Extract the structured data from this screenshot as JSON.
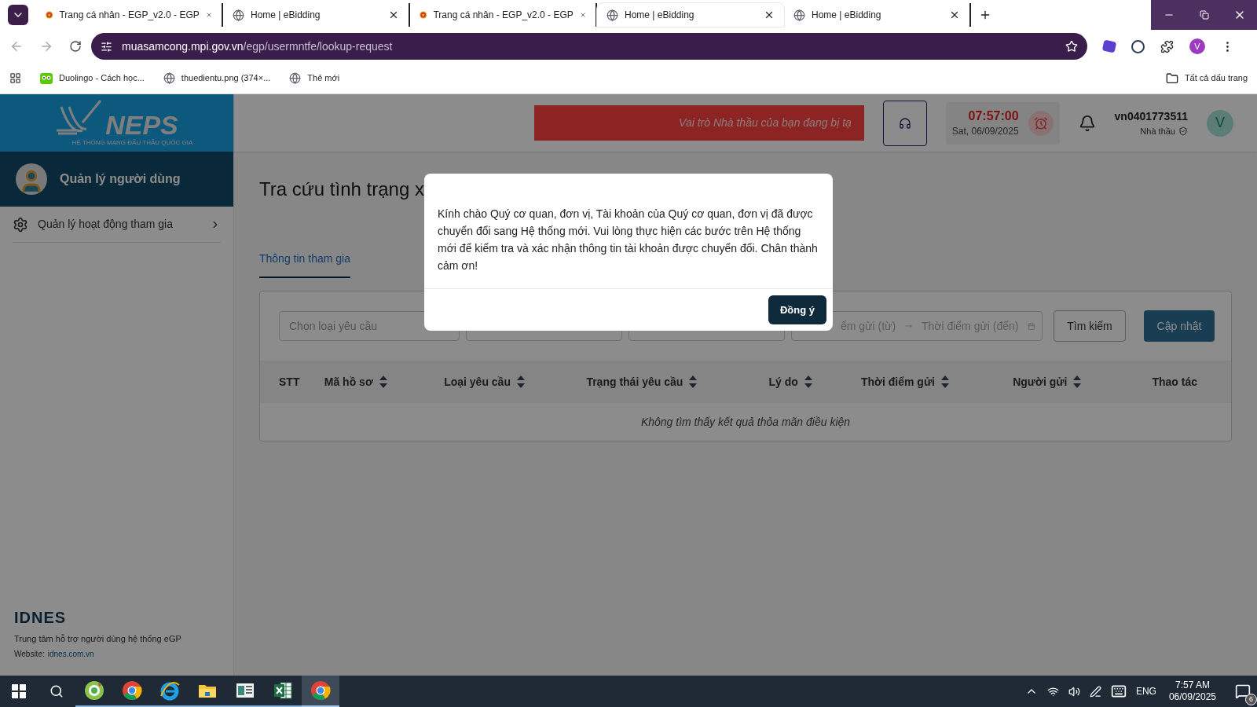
{
  "browser": {
    "tabs": [
      {
        "title": "Trang cá nhân - EGP_v2.0 - EGP",
        "kind": "emblem",
        "selected": false
      },
      {
        "title": "Home | eBidding",
        "kind": "globe",
        "selected": false
      },
      {
        "title": "Trang cá nhân - EGP_v2.0 - EGP",
        "kind": "emblem",
        "selected": false
      },
      {
        "title": "Home | eBidding",
        "kind": "globe",
        "selected": true
      },
      {
        "title": "Home | eBidding",
        "kind": "globe",
        "selected": false
      }
    ],
    "url_host": "muasamcong.mpi.gov.vn",
    "url_path": "/egp/usermntfe/lookup-request",
    "profile": "V",
    "bookmarks": [
      {
        "label": "Duolingo - Cách học...",
        "kind": "owl"
      },
      {
        "label": "thuedientu.png (374×...",
        "kind": "globe"
      },
      {
        "label": "Thẻ mới",
        "kind": "globe"
      }
    ],
    "all_bookmarks": "Tất cả dấu trang"
  },
  "sidebar": {
    "logo_text": "NEPS",
    "logo_subtitle": "HỆ THỐNG MẠNG ĐẤU THẦU QUỐC GIA",
    "user_section": "Quản lý người dùng",
    "items": [
      {
        "label": "Quản lý hoạt động tham gia",
        "expanded": false
      }
    ],
    "footer": {
      "logo": "IDNES",
      "support": "Trung tâm hỗ trợ người dùng hệ thống eGP",
      "website_label": "Website:",
      "website": "idnes.com.vn"
    }
  },
  "header": {
    "banner": "Vai trò Nhà thầu của bạn đang bị tạ",
    "time": "07:57:00",
    "date": "Sat, 06/09/2025",
    "username": "vn0401773511",
    "role": "Nhà thầu",
    "avatar": "V"
  },
  "page": {
    "title": "Tra cứu tình trạng x",
    "tabs": [
      {
        "label": "Thông tin tham gia",
        "selected": true
      }
    ],
    "filters": {
      "request_type_placeholder": "Chọn loại yêu cầu",
      "date_from_placeholder": "ểm gửi (từ)",
      "date_to_placeholder": "Thời điểm gửi (đến)",
      "search_button": "Tìm kiếm",
      "update_button": "Cập nhật"
    },
    "table": {
      "columns": [
        {
          "label": "STT",
          "sortable": false
        },
        {
          "label": "Mã hồ sơ",
          "sortable": true
        },
        {
          "label": "Loại yêu cầu",
          "sortable": true
        },
        {
          "label": "Trạng thái yêu cầu",
          "sortable": true
        },
        {
          "label": "Lý do",
          "sortable": true
        },
        {
          "label": "Thời điểm gửi",
          "sortable": true
        },
        {
          "label": "Người gửi",
          "sortable": true
        },
        {
          "label": "Thao tác",
          "sortable": false
        }
      ],
      "empty_message": "Không tìm thấy kết quả thỏa mãn điều kiện"
    }
  },
  "dialog": {
    "message": "Kính chào Quý cơ quan, đơn vị, Tài khoản của Quý cơ quan, đơn vị đã được chuyển đổi sang Hệ thống mới. Vui lòng thực hiện các bước trên Hệ thống mới để kiểm tra và xác nhận thông tin tài khoản được chuyển đổi. Chân thành cảm ơn!",
    "confirm_button": "Đồng ý"
  },
  "taskbar": {
    "apps": [
      {
        "kind": "leaf",
        "selected": false
      },
      {
        "kind": "chrome",
        "selected": false
      },
      {
        "kind": "ie",
        "selected": false
      },
      {
        "kind": "folder",
        "selected": false
      },
      {
        "kind": "doc",
        "selected": false
      },
      {
        "kind": "sheet",
        "selected": false
      },
      {
        "kind": "chrome",
        "selected": true
      }
    ],
    "language": "ENG",
    "time": "7:57 AM",
    "date": "06/09/2025",
    "notifications": "6"
  }
}
